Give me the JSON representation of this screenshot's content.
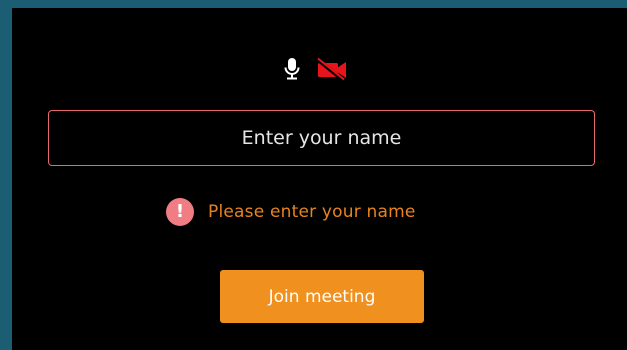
{
  "media_controls": {
    "mic_icon": "microphone-icon",
    "camera_icon": "camera-off-icon",
    "camera_off_color": "#e8141b",
    "mic_color": "#ffffff"
  },
  "name_input": {
    "placeholder": "Enter your name",
    "value": "",
    "border_color": "#e86a6f"
  },
  "error": {
    "icon": "exclamation-circle-icon",
    "icon_glyph": "!",
    "message": "Please enter your name",
    "text_color": "#e8841f",
    "icon_color": "#f07d84"
  },
  "join_button": {
    "label": "Join meeting",
    "color": "#f0901e"
  },
  "colors": {
    "page_background": "#1b5e73",
    "panel_background": "#000000"
  }
}
